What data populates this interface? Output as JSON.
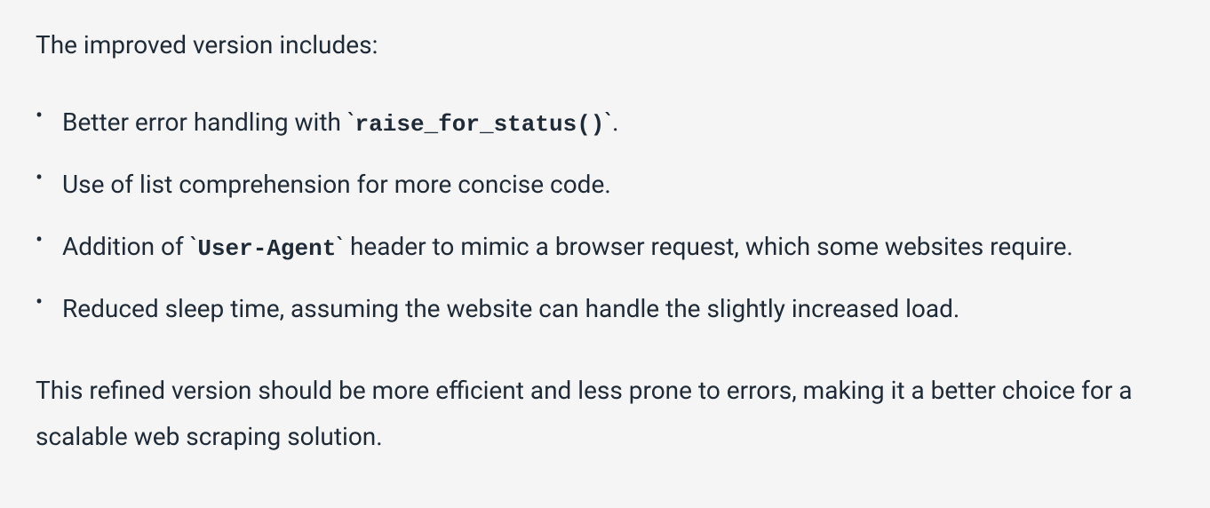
{
  "intro": "The improved version includes:",
  "bullets": [
    {
      "prefix": "Better error handling with ",
      "code": "raise_for_status()",
      "suffix": "."
    },
    {
      "prefix": "Use of list comprehension for more concise code.",
      "code": "",
      "suffix": ""
    },
    {
      "prefix": "Addition of ",
      "code": "User-Agent",
      "suffix": " header to mimic a browser request, which some websites require."
    },
    {
      "prefix": "Reduced sleep time, assuming the website can handle the slightly increased load.",
      "code": "",
      "suffix": ""
    }
  ],
  "conclusion": "This refined version should be more efficient and less prone to errors, making it a better choice for a scalable web scraping solution."
}
